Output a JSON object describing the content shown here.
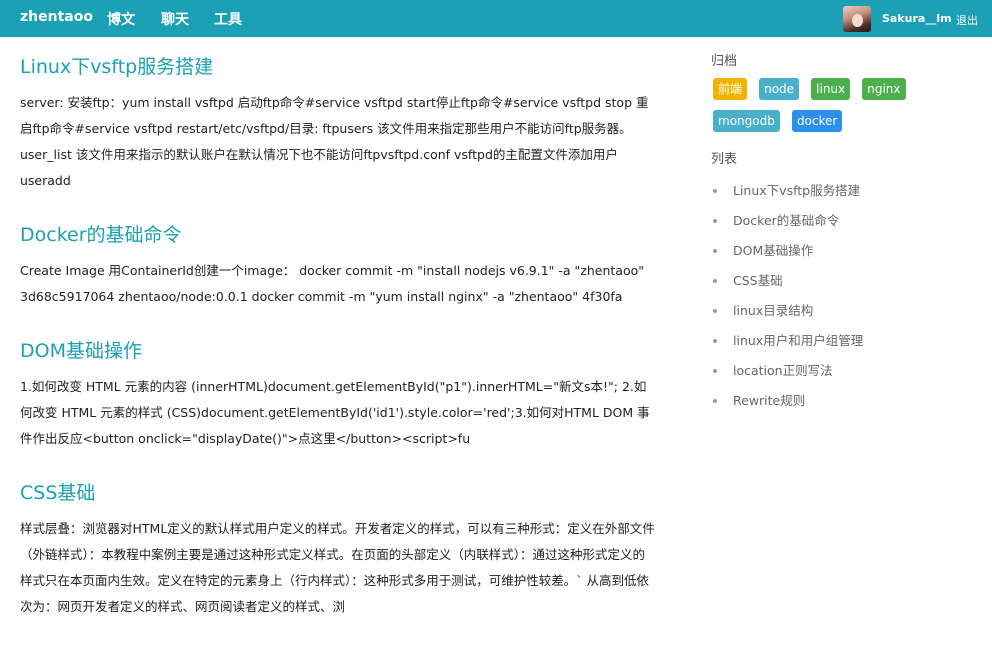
{
  "nav": {
    "brand": "zhentaoo",
    "items": [
      "博文",
      "聊天",
      "工具"
    ],
    "username": "Sakura__lm",
    "logout": "退出"
  },
  "posts": [
    {
      "title": "Linux下vsftp服务搭建",
      "body": "server: 安装ftp：yum install vsftpd  启动ftp命令#service vsftpd start停止ftp命令#service vsftpd stop  重启ftp命令#service vsftpd restart/etc/vsftpd/目录: ftpusers    该文件用来指定那些用户不能访问ftp服务器。user_list   该文件用来指示的默认账户在默认情况下也不能访问ftpvsftpd.conf   vsftpd的主配置文件添加用户useradd"
    },
    {
      "title": "Docker的基础命令",
      "body": "Create Image    用ContainerId创建一个image：     docker commit -m \"install nodejs v6.9.1\" -a \"zhentaoo\" 3d68c5917064 zhentaoo/node:0.0.1    docker commit -m \"yum install nginx\" -a \"zhentaoo\" 4f30fa"
    },
    {
      "title": "DOM基础操作",
      "body": "1.如何改变 HTML 元素的内容 (innerHTML)document.getElementById(\"p1\").innerHTML=\"新文s本!\"; 2.如何改变 HTML 元素的样式 (CSS)document.getElementById('id1').style.color='red';3.如何对HTML DOM 事件作出反应<button onclick=\"displayDate()\">点这里</button><script>fu"
    },
    {
      "title": "CSS基础",
      "body": "样式层叠：浏览器对HTML定义的默认样式用户定义的样式。开发者定义的样式，可以有三种形式：定义在外部文件（外链样式）：本教程中案例主要是通过这种形式定义样式。在页面的头部定义（内联样式）：通过这种形式定义的样式只在本页面内生效。定义在特定的元素身上（行内样式）：这种形式多用于测试，可维护性较差。`     从高到低依次为：网页开发者定义的样式、网页阅读者定义的样式、浏"
    }
  ],
  "sidebar": {
    "archive_title": "归档",
    "tags": [
      {
        "label": "前端",
        "color": "#f0b400"
      },
      {
        "label": "node",
        "color": "#48b0c8"
      },
      {
        "label": "linux",
        "color": "#4cae4c"
      },
      {
        "label": "nginx",
        "color": "#4cae4c"
      },
      {
        "label": "mongodb",
        "color": "#48b0c8"
      },
      {
        "label": "docker",
        "color": "#2d8fe8"
      }
    ],
    "list_title": "列表",
    "list": [
      "Linux下vsftp服务搭建",
      "Docker的基础命令",
      "DOM基础操作",
      "CSS基础",
      "linux目录结构",
      "linux用户和用户组管理",
      "location正则写法",
      "Rewrite规则"
    ]
  }
}
